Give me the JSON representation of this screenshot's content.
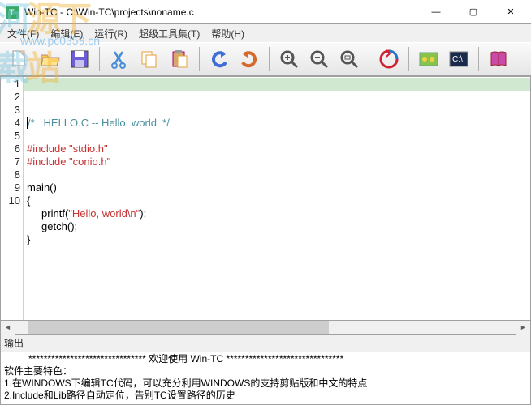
{
  "watermark": {
    "url": "www.pc0359.cn"
  },
  "window": {
    "title": "Win-TC - C:\\Win-TC\\projects\\noname.c",
    "minimize": "—",
    "maximize": "▢",
    "close": "✕"
  },
  "menu": {
    "file": "文件(F)",
    "edit": "编辑(E)",
    "run": "运行(R)",
    "tools": "超级工具集(T)",
    "help": "帮助(H)"
  },
  "toolbar_icons": {
    "new": "new-file-icon",
    "open": "open-folder-icon",
    "save": "save-icon",
    "cut": "cut-icon",
    "copy": "copy-icon",
    "paste": "paste-icon",
    "undo": "undo-icon",
    "redo": "redo-icon",
    "zoomin": "zoom-in-icon",
    "zoomout": "zoom-out-icon",
    "zoomfit": "zoom-fit-icon",
    "compile": "compile-icon",
    "run": "run-icon",
    "cmd": "console-icon",
    "help": "help-book-icon"
  },
  "editor": {
    "line_numbers": [
      "1",
      "2",
      "3",
      "4",
      "5",
      "6",
      "7",
      "8",
      "9",
      "10"
    ],
    "lines": [
      {
        "type": "comment",
        "text": "/*   HELLO.C -- Hello, world  */"
      },
      {
        "type": "blank",
        "text": ""
      },
      {
        "type": "preproc",
        "pre": "#include ",
        "str": "\"stdio.h\""
      },
      {
        "type": "preproc",
        "pre": "#include ",
        "str": "\"conio.h\""
      },
      {
        "type": "blank",
        "text": ""
      },
      {
        "type": "plain",
        "text": "main()"
      },
      {
        "type": "plain",
        "text": "{"
      },
      {
        "type": "call",
        "indent": "     ",
        "fn": "printf(",
        "str": "\"Hello, world\\n\"",
        "tail": ");"
      },
      {
        "type": "plain",
        "text": "     getch();"
      },
      {
        "type": "plain",
        "text": "}"
      }
    ]
  },
  "output": {
    "label": "输出",
    "welcome_stars_l": "*******************************",
    "welcome_text": " 欢迎使用 Win-TC ",
    "welcome_stars_r": "*******************************",
    "features_header": "软件主要特色：",
    "feature1": "1.在WINDOWS下编辑TC代码，可以充分利用WINDOWS的支持剪贴版和中文的特点",
    "feature2": "2.Include和Lib路径自动定位，告别TC设置路径的历史"
  }
}
